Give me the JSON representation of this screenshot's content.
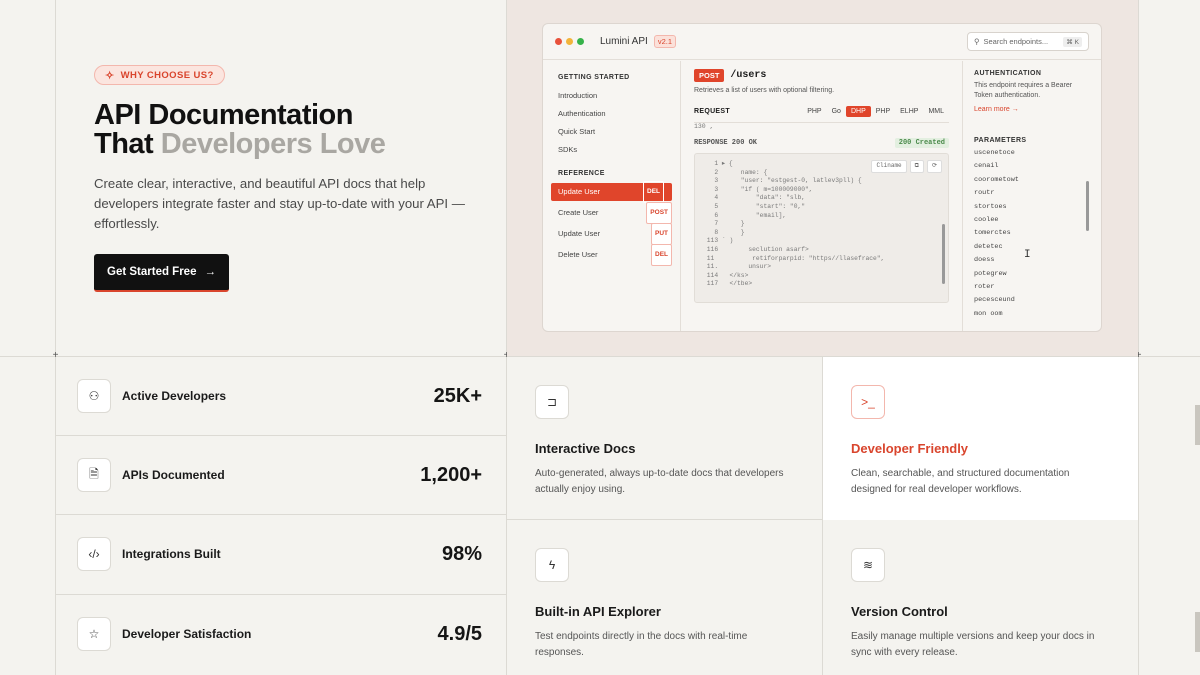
{
  "hero": {
    "badge": "WHY CHOOSE US?",
    "title_line1": "API Documentation",
    "title_line2_strong": "That",
    "title_line2_muted": "Developers Love",
    "lead": "Create clear, interactive, and beautiful API docs that help developers integrate faster and stay up-to-date with your API — effortlessly.",
    "cta": "Get Started Free",
    "cta_arrow": "→"
  },
  "preview": {
    "app_name": "Lumini API",
    "version": "v2.1",
    "search_placeholder": "Search endpoints...",
    "search_kbd": "⌘ K",
    "sidebar": {
      "section1": "GETTING STARTED",
      "items1": [
        "Introduction",
        "Authentication",
        "Quick Start",
        "SDKs"
      ],
      "section2": "REFERENCE",
      "items2": [
        {
          "label": "Update User",
          "method": "DEL"
        },
        {
          "label": "Create User",
          "method": "POST"
        },
        {
          "label": "Update User",
          "method": "PUT"
        },
        {
          "label": "Delete User",
          "method": "DEL"
        }
      ]
    },
    "endpoint": {
      "method": "POST",
      "path": "/users",
      "description": "Retrieves a list of users with optional filtering.",
      "request_label": "REQUEST",
      "languages": [
        "PHP",
        "Go",
        "DHP",
        "PHP",
        "ELHP",
        "MML"
      ],
      "active_language": "DHP",
      "snippet": "130    ,",
      "response_label": "RESPONSE  200  OK",
      "response_status": "200 Created",
      "tools": [
        "Cliname",
        "⧉",
        "⟳"
      ],
      "code": "   1 ▸ {\n   2      name: {\n   3      \"user: \"estgest-0, latlev3pll) {\n   3      \"if ( m=100009000\",\n   4          \"data\": \"slb,\n   5          \"start\": \"0,\"\n   6          \"email],\n   7      }\n   8      }\n 113 ` )\n 116        seclution asarf>\n 11          retiforparpid: \"https//llasefrace\",\n 11.        unsur>\n 114   </ks>\n 117   </tbe>"
    },
    "right": {
      "auth_title": "AUTHENTICATION",
      "auth_text": "This endpoint requires a Bearer Token authentication.",
      "auth_link": "Learn more →",
      "params_title": "PARAMETERS",
      "params": [
        "uscenetoce",
        "cenail",
        "coorometowt",
        "routr",
        "stortoes",
        "coolee",
        "tomerctes",
        "detetec",
        "doess",
        "potegrew",
        "roter",
        "pecesceund",
        "mon oom"
      ]
    }
  },
  "stats": [
    {
      "icon": "users-icon",
      "glyph": "⚇",
      "label": "Active Developers",
      "value": "25K+"
    },
    {
      "icon": "document-icon",
      "glyph": "🗎",
      "label": "APIs Documented",
      "value": "1,200+"
    },
    {
      "icon": "code-icon",
      "glyph": "‹/›",
      "label": "Integrations Built",
      "value": "98%"
    },
    {
      "icon": "star-icon",
      "glyph": "☆",
      "label": "Developer Satisfaction",
      "value": "4.9/5"
    }
  ],
  "features": [
    {
      "icon": "book-icon",
      "glyph": "⊐",
      "title": "Interactive Docs",
      "desc": "Auto-generated, always up-to-date docs that developers actually enjoy using."
    },
    {
      "icon": "terminal-icon",
      "glyph": ">_",
      "title": "Developer Friendly",
      "desc": "Clean, searchable, and structured documentation designed for real developer workflows."
    },
    {
      "icon": "bolt-icon",
      "glyph": "ϟ",
      "title": "Built-in API Explorer",
      "desc": "Test endpoints directly in the docs with real-time responses."
    },
    {
      "icon": "layers-icon",
      "glyph": "≋",
      "title": "Version Control",
      "desc": "Easily manage multiple versions and keep your docs in sync with every release."
    }
  ],
  "colors": {
    "accent": "#d9452d",
    "background": "#f4f3ef",
    "dark": "#111111"
  }
}
